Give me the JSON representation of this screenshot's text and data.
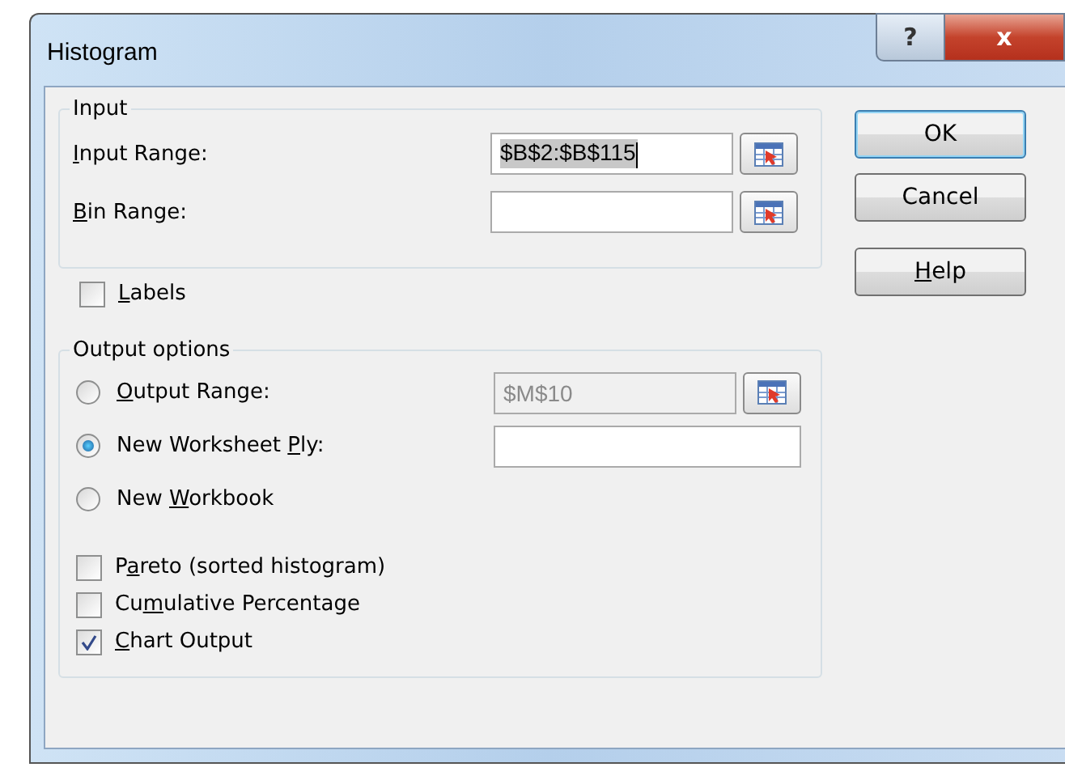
{
  "window": {
    "title": "Histogram",
    "help_button": "?",
    "close_button": "x"
  },
  "input_group": {
    "title": "Input",
    "fields": [
      {
        "label": {
          "key": "I",
          "post": "nput Range:"
        },
        "value": "$B$2:$B$115",
        "highlighted": true
      },
      {
        "label": {
          "key": "B",
          "post": "in Range:"
        }
      }
    ]
  },
  "labels_checkbox": {
    "label": {
      "key": "L",
      "post": "abels"
    },
    "checked": false
  },
  "output_group": {
    "title": "Output options",
    "radios": [
      {
        "label": {
          "key": "O",
          "post": "utput Range:"
        },
        "selected": false,
        "kind": "range",
        "field": {
          "value": "$M$10",
          "disabled": true
        }
      },
      {
        "label": {
          "pre": "New Worksheet ",
          "key": "P",
          "post": "ly:"
        },
        "selected": true,
        "kind": "text"
      },
      {
        "label": {
          "pre": "New ",
          "key": "W",
          "post": "orkbook"
        },
        "selected": false,
        "kind": "plain"
      }
    ],
    "checkboxes": [
      {
        "label": {
          "pre": "P",
          "key": "a",
          "post": "reto (sorted histogram)"
        },
        "checked": false
      },
      {
        "label": {
          "pre": "Cu",
          "key": "m",
          "post": "ulative Percentage"
        },
        "checked": false
      },
      {
        "label": {
          "key": "C",
          "post": "hart Output"
        },
        "checked": true
      }
    ]
  },
  "buttons": [
    {
      "label": {
        "pre": "OK"
      },
      "default": true
    },
    {
      "label": {
        "pre": "Cancel"
      },
      "default": false
    },
    {
      "label": {
        "key": "H",
        "post": "elp"
      },
      "default": false
    }
  ]
}
